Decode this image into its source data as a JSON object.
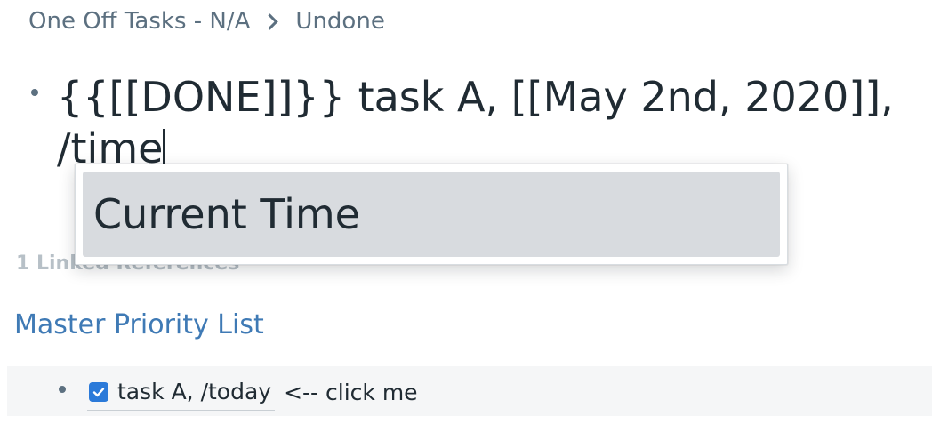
{
  "breadcrumb": {
    "parent": "One Off Tasks - N/A",
    "current": "Undone"
  },
  "block": {
    "text": "{{[[DONE]]}} task A, [[May 2nd, 2020]], /time"
  },
  "autocomplete": {
    "items": [
      {
        "label": "Current Time"
      }
    ]
  },
  "linked_references": {
    "header": "1 Linked References",
    "groups": [
      {
        "page_title": "Master Priority List",
        "blocks": [
          {
            "checked": true,
            "text": "task A, /today",
            "suffix": "<-- click me"
          }
        ]
      }
    ]
  },
  "colors": {
    "link": "#3f7ab5",
    "checkbox": "#2b7ad9",
    "highlight": "#d8dbdf",
    "muted": "#5c7080"
  }
}
